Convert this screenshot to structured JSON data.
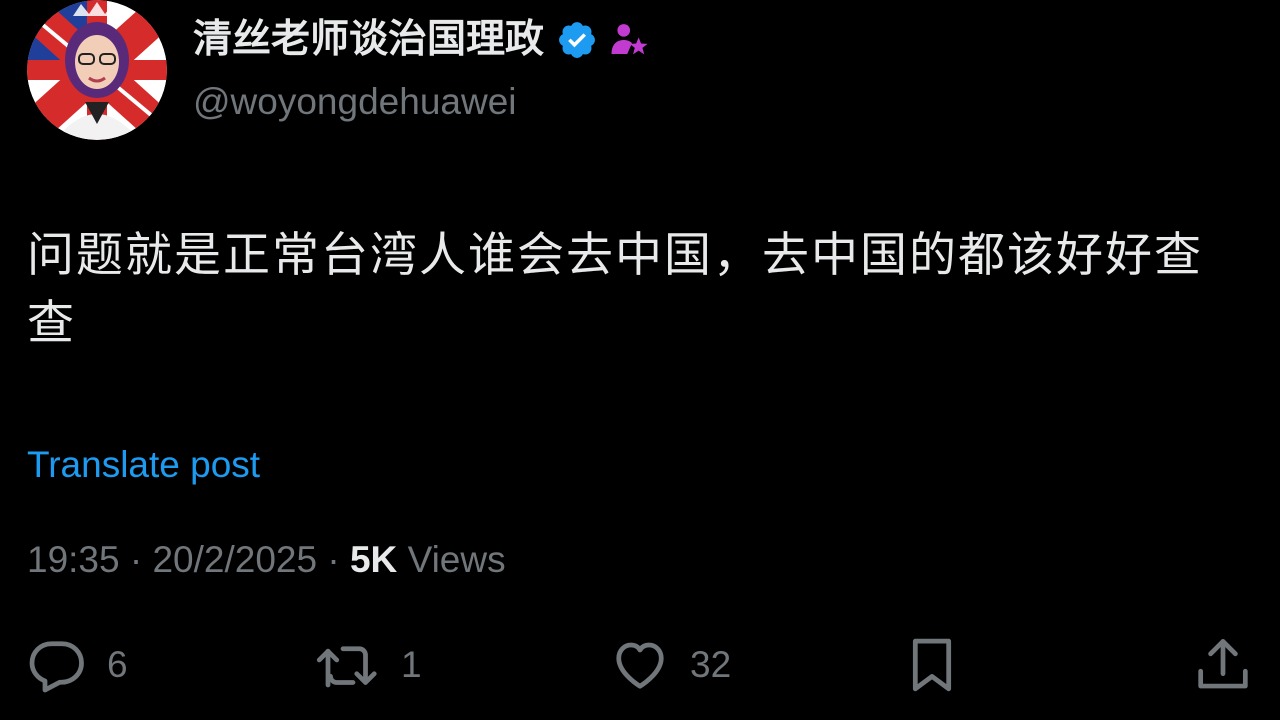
{
  "author": {
    "display_name": "清丝老师谈治国理政",
    "handle": "@woyongdehuawei",
    "verified_badge_icon": "verified-check-icon",
    "affiliate_icon": "affiliate-person-star-icon",
    "verified_color": "#1d9bf0",
    "affiliate_color": "#c23bd0"
  },
  "post": {
    "text": "问题就是正常台湾人谁会去中国，去中国的都该好好查查",
    "translate_label": "Translate post"
  },
  "meta": {
    "time": "19:35",
    "date": "20/2/2025",
    "separator": "·",
    "views_count": "5K",
    "views_label": "Views"
  },
  "actions": {
    "replies": "6",
    "reposts": "1",
    "likes": "32"
  },
  "colors": {
    "background": "#000000",
    "primary_text": "#e7e9ea",
    "secondary_text": "#71767b",
    "link": "#1d9bf0"
  }
}
